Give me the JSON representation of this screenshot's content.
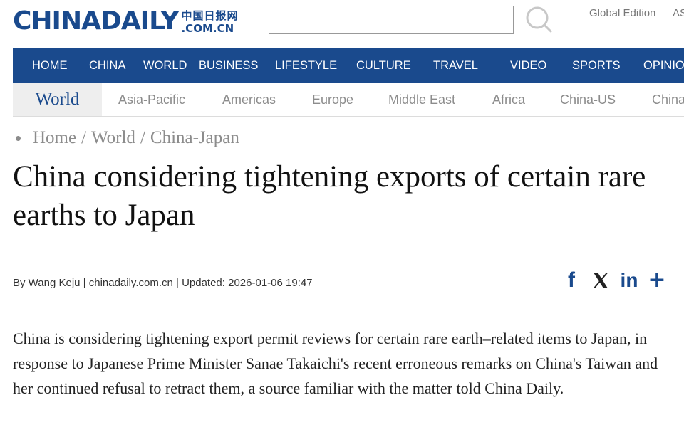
{
  "header": {
    "logo_main": "CHINADAILY",
    "logo_cn": "中国日报网",
    "logo_domain": ".COM.CN",
    "search_value": "",
    "search_placeholder": "",
    "search_icon": "search-icon",
    "global_edition": "Global Edition",
    "asia_edition": "ASIA"
  },
  "nav": {
    "items": [
      "HOME",
      "CHINA",
      "WORLD",
      "BUSINESS",
      "LIFESTYLE",
      "CULTURE",
      "TRAVEL",
      "VIDEO",
      "SPORTS",
      "OPINION"
    ]
  },
  "subnav": {
    "current": "World",
    "items": [
      "Asia-Pacific",
      "Americas",
      "Europe",
      "Middle East",
      "Africa",
      "China-US",
      "China-Europe"
    ]
  },
  "breadcrumb": {
    "items": [
      "Home",
      "World",
      "China-Japan"
    ],
    "separator": "/"
  },
  "article": {
    "headline": "China considering tightening exports of certain rare earths to Japan",
    "byline": "By Wang Keju | chinadaily.com.cn | Updated: 2026-01-06 19:47",
    "paragraph": "China is considering tightening export permit reviews for certain rare earth–related items to Japan, in response to Japanese Prime Minister Sanae Takaichi's recent erroneous remarks on China's Taiwan and her continued refusal to retract them, a source familiar with the matter told China Daily."
  },
  "share": {
    "facebook": "f",
    "linkedin": "in",
    "more": "+",
    "icons": [
      "facebook-icon",
      "x-icon",
      "linkedin-icon",
      "plus-icon"
    ]
  },
  "colors": {
    "brand_blue": "#1a4a8d",
    "nav_text": "#ffffff",
    "muted_text": "#8c8c8c",
    "subnav_active_bg": "#eeeeee"
  }
}
